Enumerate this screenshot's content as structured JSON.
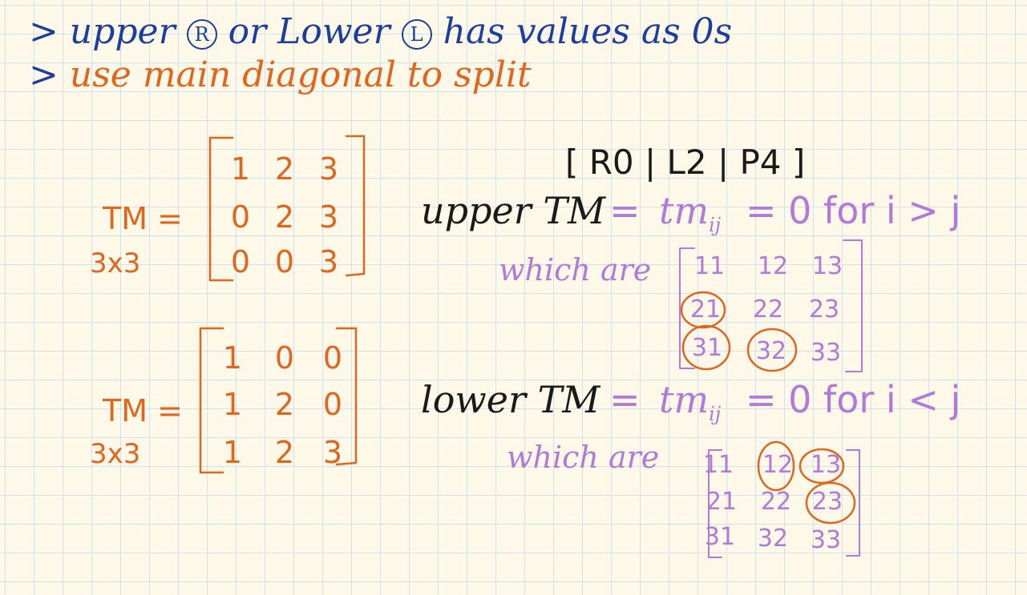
{
  "colors": {
    "blue": "#1d3f9b",
    "orange": "#e0661e",
    "black": "#1a1a1a",
    "purple": "#b07ad6",
    "grid": "#cfe3ee",
    "paper": "#fdf8e8"
  },
  "notes": {
    "line1": {
      "prefix": ">",
      "upper": "upper",
      "r_mark": "R",
      "or": "or",
      "lower": "Lower",
      "l_mark": "L",
      "rest": "has values as 0s"
    },
    "line2": {
      "prefix": ">",
      "text": "use main diagonal to split"
    }
  },
  "matrix_upper_example": {
    "label": "TM =",
    "dim": "3x3",
    "rows": [
      [
        "1",
        "2",
        "3"
      ],
      [
        "0",
        "2",
        "3"
      ],
      [
        "0",
        "0",
        "3"
      ]
    ]
  },
  "matrix_lower_example": {
    "label": "TM =",
    "dim": "3x3",
    "rows": [
      [
        "1",
        "0",
        "0"
      ],
      [
        "1",
        "2",
        "0"
      ],
      [
        "1",
        "2",
        "3"
      ]
    ]
  },
  "tag": "[ R0 | L2 | P4 ]",
  "upper_definition": {
    "lhs": "upper TM",
    "eq": "=",
    "rhs": "tm",
    "subscript": "ij",
    "condition": "= 0 for i > j",
    "which_are": "which are",
    "indices": [
      [
        "11",
        "12",
        "13"
      ],
      [
        "21",
        "22",
        "23"
      ],
      [
        "31",
        "32",
        "33"
      ]
    ],
    "circled": [
      "21",
      "31",
      "32"
    ]
  },
  "lower_definition": {
    "lhs": "lower TM",
    "eq": "=",
    "rhs": "tm",
    "subscript": "ij",
    "condition": "= 0 for i < j",
    "which_are": "which are",
    "indices": [
      [
        "11",
        "12",
        "13"
      ],
      [
        "21",
        "22",
        "23"
      ],
      [
        "31",
        "32",
        "33"
      ]
    ],
    "circled": [
      "12",
      "13",
      "23"
    ]
  }
}
